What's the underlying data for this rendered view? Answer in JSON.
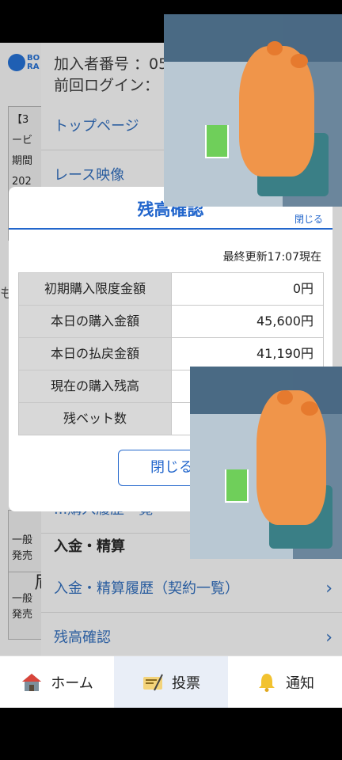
{
  "header": {
    "member_label": "加入者番号 ：05",
    "last_login_label": "前回ログイン："
  },
  "menu": {
    "top_page": "トップページ",
    "race_video": "レース映像",
    "section_deposit": "入金・精算",
    "deposit_history": "入金・精算履歴（契約一覧）",
    "balance_check": "残高確認",
    "partial_text": "...購入履歴一覧"
  },
  "left_cards": {
    "card1_line1": "【3",
    "card1_line2": "ービ",
    "card1_line3": "期間",
    "card1_line4": "202",
    "side_text": "も",
    "card2_line1": "一般",
    "card2_line2": "発売",
    "card3_line1": "尼",
    "card3_line2": "一般",
    "card3_line3": "発売"
  },
  "modal": {
    "title": "残高確認",
    "close_x": "閉じる",
    "updated": "最終更新17:07現在",
    "rows": [
      {
        "label": "初期購入限度金額",
        "value": "0円"
      },
      {
        "label": "本日の購入金額",
        "value": "45,600円"
      },
      {
        "label": "本日の払戻金額",
        "value": "41,190円"
      },
      {
        "label": "現在の購入残高",
        "value": ""
      },
      {
        "label": "残ベット数",
        "value": ""
      }
    ],
    "close_button": "閉じる"
  },
  "bottom_nav": {
    "home": "ホーム",
    "vote": "投票",
    "notify": "通知"
  },
  "colors": {
    "accent": "#2266cc",
    "link": "#2a5d9f"
  }
}
